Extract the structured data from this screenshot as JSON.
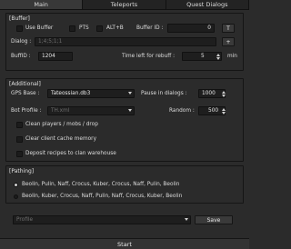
{
  "tabs": [
    {
      "label": "Main",
      "active": true
    },
    {
      "label": "Teleports",
      "active": false
    },
    {
      "label": "Quest Dialogs",
      "active": false
    }
  ],
  "buffer": {
    "title": "[Buffer]",
    "use_buffer_label": "Use Buffer",
    "use_buffer_checked": false,
    "pts_label": "PTS",
    "pts_checked": false,
    "altb_label": "ALT+B",
    "altb_checked": false,
    "buffer_id_label": "Buffer ID :",
    "buffer_id_value": "0",
    "t_button": "T",
    "dialog_label": "Dialog :",
    "dialog_value": "1;4;5;1;1",
    "plus_button": "+",
    "buff_id_label": "BuffID :",
    "buff_id_value": "1204",
    "time_left_label": "Time left for rebuff :",
    "time_left_value": "5",
    "min_label": "min"
  },
  "additional": {
    "title": "[Additional]",
    "gps_base_label": "GPS Base :",
    "gps_base_value": "Tateossian.db3",
    "pause_label": "Pause in dialogs :",
    "pause_value": "1000",
    "bot_profile_label": "Bot Profile :",
    "bot_profile_value": "TH.xml",
    "random_label": "Random :",
    "random_value": "500",
    "checks": [
      {
        "label": "Clean players / mobs / drop",
        "checked": false
      },
      {
        "label": "Clear client cache memory",
        "checked": false
      },
      {
        "label": "Deposit recipes to clan warehouse",
        "checked": false
      }
    ]
  },
  "pathing": {
    "title": "[Pathing]",
    "routes": [
      {
        "label": "Beolin, Pulin, Naff, Crocus, Kuber, Crocus, Naff, Pulin, Beolin",
        "selected": true
      },
      {
        "label": "Beolin, Kuber, Crocus, Naff, Pulin, Naff, Crocus, Kuber, Beolin",
        "selected": false
      }
    ]
  },
  "profile": {
    "placeholder": "Profile",
    "save_label": "Save"
  },
  "start_label": "Start"
}
